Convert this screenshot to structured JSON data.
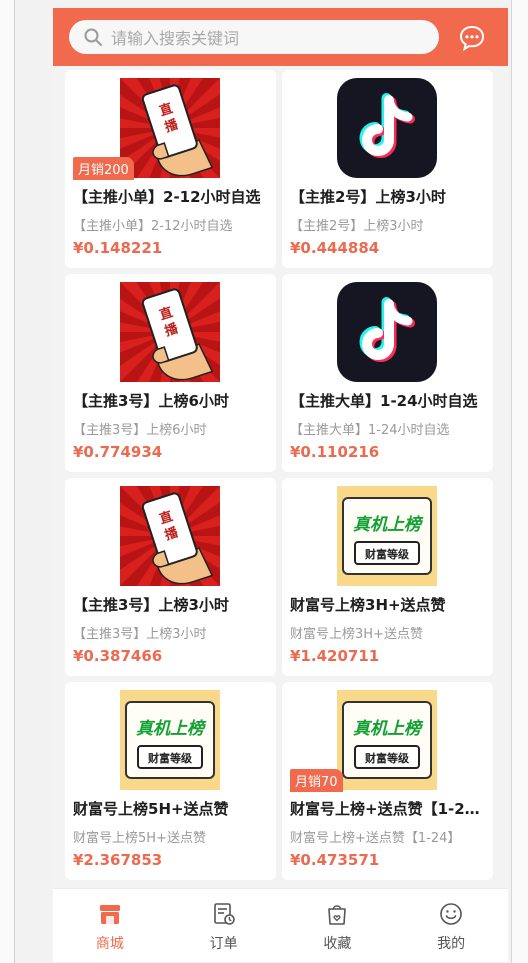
{
  "search": {
    "placeholder": "请输入搜索关键词"
  },
  "products": [
    {
      "title": "【主推小单】2-12小时自选",
      "subtitle": "【主推小单】2-12小时自选",
      "price": "¥0.148221",
      "sales": "月销200",
      "image": "live-stream-icon"
    },
    {
      "title": "【主推2号】上榜3小时",
      "subtitle": "【主推2号】上榜3小时",
      "price": "¥0.444884",
      "sales": "",
      "image": "tiktok-logo-icon"
    },
    {
      "title": "【主推3号】上榜6小时",
      "subtitle": "【主推3号】上榜6小时",
      "price": "¥0.774934",
      "sales": "",
      "image": "live-stream-icon"
    },
    {
      "title": "【主推大单】1-24小时自选",
      "subtitle": "【主推大单】1-24小时自选",
      "price": "¥0.110216",
      "sales": "",
      "image": "tiktok-logo-icon"
    },
    {
      "title": "【主推3号】上榜3小时",
      "subtitle": "【主推3号】上榜3小时",
      "price": "¥0.387466",
      "sales": "",
      "image": "live-stream-icon"
    },
    {
      "title": "财富号上榜3H+送点赞",
      "subtitle": "财富号上榜3H+送点赞",
      "price": "¥1.420711",
      "sales": "",
      "image": "wealth-rank-icon"
    },
    {
      "title": "财富号上榜5H+送点赞",
      "subtitle": "财富号上榜5H+送点赞",
      "price": "¥2.367853",
      "sales": "",
      "image": "wealth-rank-icon"
    },
    {
      "title": "财富号上榜+送点赞【1-24】",
      "subtitle": "财富号上榜+送点赞【1-24】",
      "price": "¥0.473571",
      "sales": "月销70",
      "image": "wealth-rank-icon"
    }
  ],
  "image_text": {
    "live": "直播",
    "rank_main": "真机上榜",
    "rank_sub": "财富等级"
  },
  "nav": [
    {
      "label": "商城",
      "icon": "shop-icon",
      "active": true
    },
    {
      "label": "订单",
      "icon": "order-icon",
      "active": false
    },
    {
      "label": "收藏",
      "icon": "favorite-bag-icon",
      "active": false
    },
    {
      "label": "我的",
      "icon": "profile-smile-icon",
      "active": false
    }
  ],
  "colors": {
    "accent": "#f26a4d",
    "price": "#ec6a4f"
  }
}
